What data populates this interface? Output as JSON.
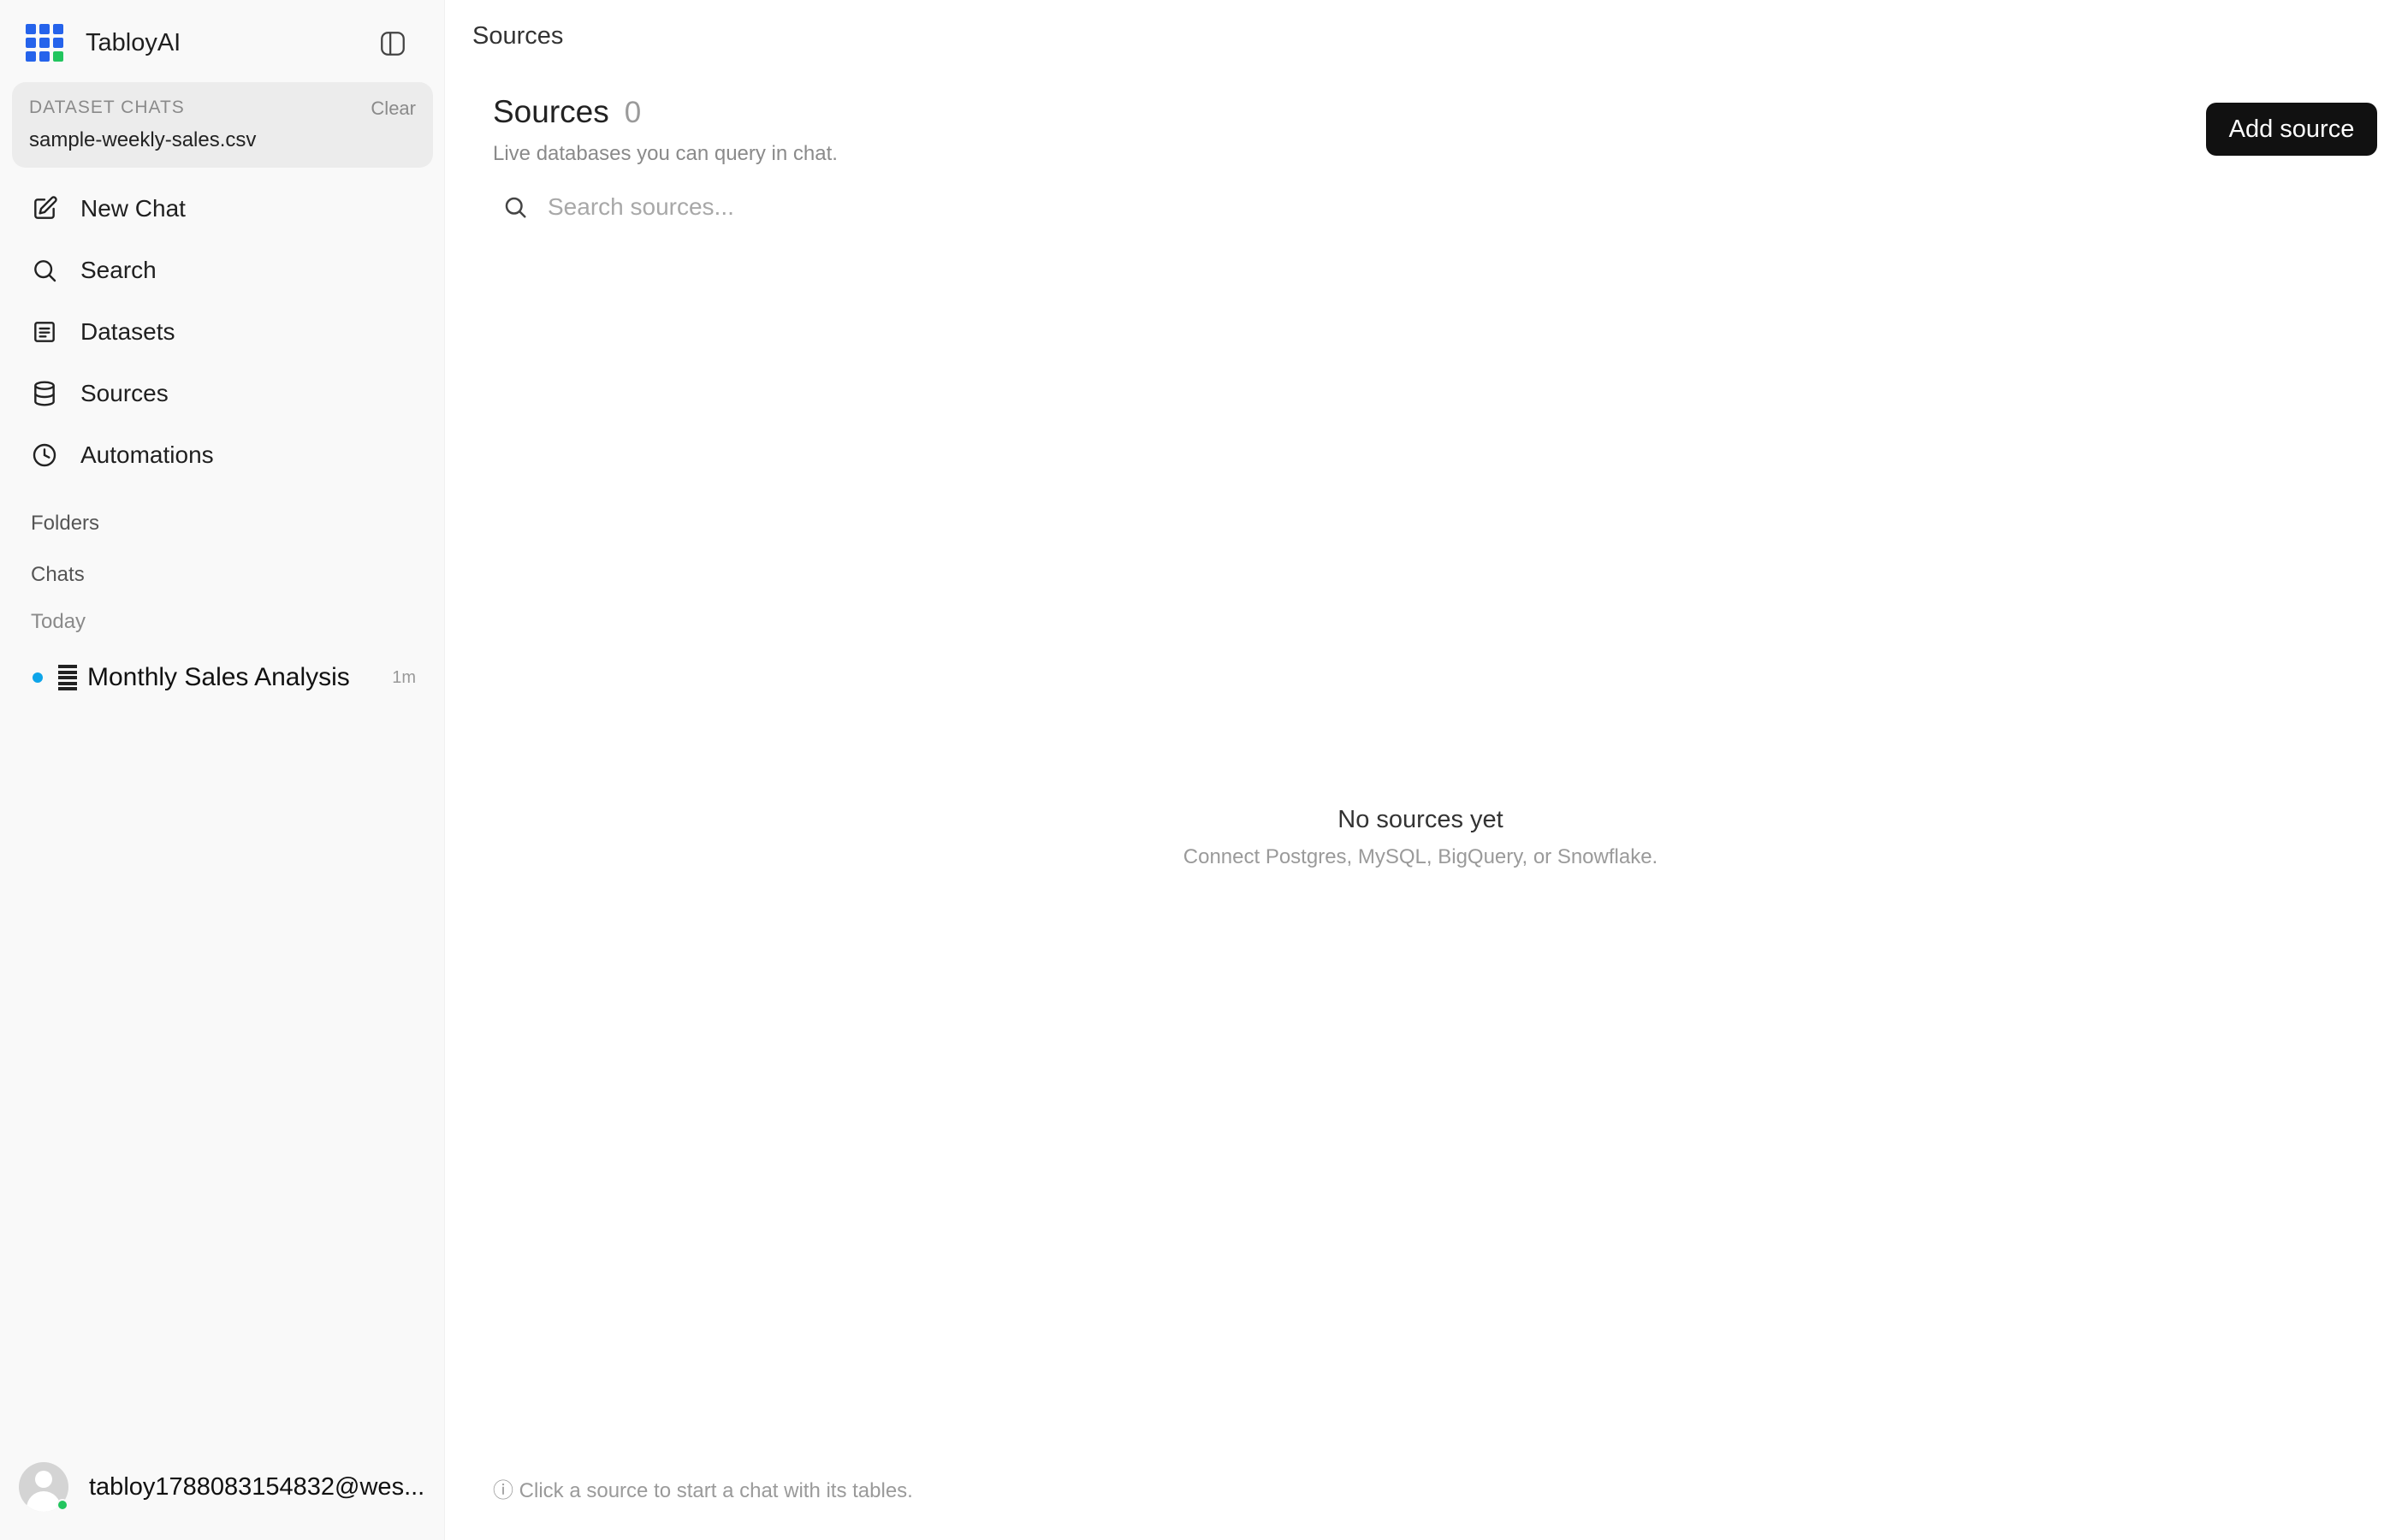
{
  "app": {
    "name": "TabloyAI"
  },
  "dataset_chats": {
    "heading": "DATASET CHATS",
    "clear_label": "Clear",
    "file_name": "sample-weekly-sales.csv"
  },
  "nav": {
    "items": [
      {
        "label": "New Chat",
        "icon": "edit-icon"
      },
      {
        "label": "Search",
        "icon": "search-icon"
      },
      {
        "label": "Datasets",
        "icon": "datasets-icon"
      },
      {
        "label": "Sources",
        "icon": "database-icon"
      },
      {
        "label": "Automations",
        "icon": "clock-icon"
      }
    ]
  },
  "sections": {
    "folders": "Folders",
    "chats": "Chats",
    "today": "Today"
  },
  "chats": [
    {
      "title": "Monthly Sales Analysis",
      "time": "1m",
      "status_color": "#0ea5e9"
    }
  ],
  "user": {
    "email": "tabloy1788083154832@wes..."
  },
  "main": {
    "top_title": "Sources",
    "title": "Sources",
    "count": "0",
    "subtitle": "Live databases you can query in chat.",
    "add_button": "Add source",
    "search_placeholder": "Search sources...",
    "empty_title": "No sources yet",
    "empty_subtitle": "Connect Postgres, MySQL, BigQuery, or Snowflake.",
    "footer_hint": "ⓘ Click a source to start a chat with its tables."
  },
  "colors": {
    "brand": "#2563eb",
    "accent_green": "#22c55e",
    "primary_button": "#111111",
    "sidebar_bg": "#f9f9f9"
  }
}
